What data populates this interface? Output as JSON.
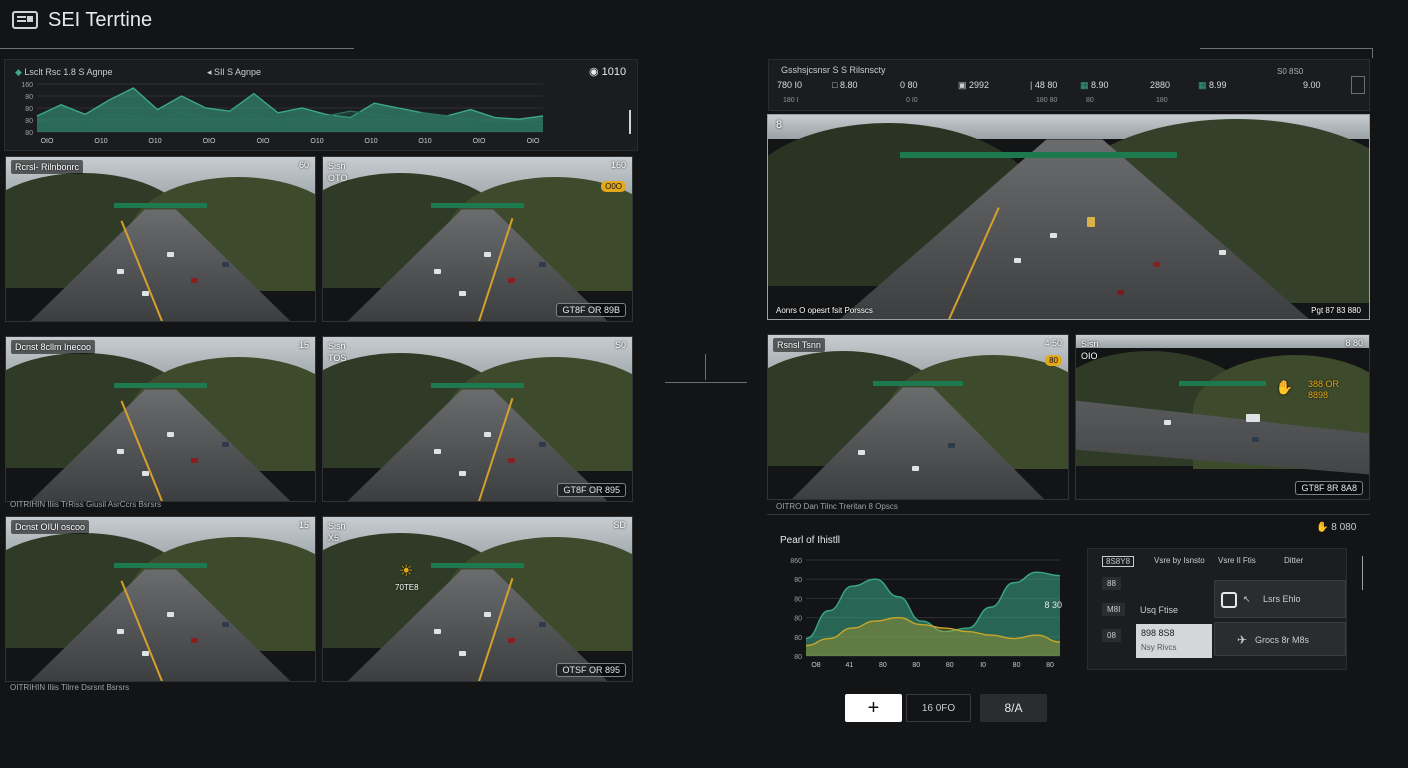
{
  "app": {
    "title": "SEI Terrtine"
  },
  "top_chart": {
    "title": "Lsclt Rsc 1.8 S Agnpe",
    "subtitle": "SIl S Agnpe",
    "right_value": "1010",
    "y_ticks": [
      "160",
      "80",
      "80",
      "80",
      "80"
    ],
    "x_ticks": [
      "OIO",
      "O10",
      "O10",
      "OIO",
      "OIO",
      "O10",
      "O10",
      "O10",
      "OIO",
      "OIO"
    ],
    "chart_data": {
      "type": "area",
      "series": [
        {
          "values": [
            20,
            34,
            22,
            40,
            55,
            28,
            45,
            30,
            26,
            48,
            24,
            30,
            22,
            18,
            36,
            30,
            24,
            20,
            28,
            18,
            16,
            20
          ]
        },
        {
          "values": [
            12,
            18,
            15,
            22,
            20,
            16,
            24,
            18,
            16,
            22,
            14,
            18,
            20,
            26,
            22,
            18,
            24,
            20,
            16,
            12,
            14,
            10
          ]
        }
      ],
      "colors": [
        "#3aa889",
        "#2a6e5c"
      ]
    }
  },
  "left_grid": {
    "tiles": [
      {
        "label": "Rcrsl- Rilnbonrc",
        "num": "60"
      },
      {
        "label": "Sisn\nOTO",
        "num": "160",
        "badge": "O0O",
        "chip": "GT8F OR 89B"
      },
      {
        "label": "Dcnst 8cllm Inecoo",
        "num": "15"
      },
      {
        "label": "Sisn\nTOS",
        "num": "S0",
        "chip": "GT8F OR 895"
      },
      {
        "label": "Dcnst OIUl oscoo",
        "num": "15"
      },
      {
        "label": "Sisn\nX5",
        "num": "SD",
        "note": "70TE8",
        "chip": "OTSF OR 895"
      }
    ],
    "captions": [
      "OITRIHIN Iliis TrRiss Giusil AsrCcrs Bsrsrs",
      "OITRIHIN Iliis Tilrre Dsrsnt Bsrsrs"
    ]
  },
  "right_panel": {
    "stats_title": "Gsshsjcsnsr S S Rilsnscty",
    "stats": [
      {
        "value": "780 I0",
        "sub": "180 I"
      },
      {
        "value": "8.80",
        "sub": ""
      },
      {
        "value": "0 80",
        "sub": "0 I0"
      },
      {
        "value": "2992",
        "sub": ""
      },
      {
        "value": "48 80",
        "sub": "180 80"
      },
      {
        "value": "8.90",
        "sub": "80"
      },
      {
        "value": "2880",
        "sub": "180"
      },
      {
        "value": "8.99",
        "sub": ""
      },
      {
        "value": "9.00",
        "sub": ""
      }
    ],
    "stats_right_label": "S0 8S0",
    "main_cam": {
      "num_label": "8",
      "caption_left": "Aonrs O opesrt fsit Porsscs",
      "caption_right": "Pgt 87 83 880"
    },
    "tiles": [
      {
        "label": "Rsnsl Tsnn",
        "num": "4 50",
        "badge": "80"
      },
      {
        "label": "Sisn\nOIO",
        "num": "8 80",
        "note": "388 OR\n8898",
        "chip": "GT8F 8R 8A8"
      }
    ],
    "tiles_caption": "OITRO Dan Tilnc Treritan 8 Opscs",
    "bottom_right_value": "8 080"
  },
  "bottom_chart": {
    "title": "Pearl of Ihistll",
    "y_ticks": [
      "860",
      "80",
      "80",
      "80",
      "80",
      "80"
    ],
    "x_ticks": [
      "O8",
      "41",
      "80",
      "80",
      "80",
      "I0",
      "80",
      "80"
    ],
    "right_value": "8 30",
    "chart_data": {
      "type": "area",
      "series": [
        {
          "values": [
            10,
            26,
            40,
            44,
            34,
            20,
            14,
            16,
            28,
            42,
            48,
            46
          ]
        },
        {
          "values": [
            6,
            10,
            16,
            20,
            22,
            18,
            16,
            14,
            12,
            10,
            12,
            8
          ]
        }
      ],
      "colors": [
        "#3aa889",
        "#c9a628"
      ]
    }
  },
  "menu": {
    "tabs": [
      "8S8Y8",
      "Vsre by Isnsto",
      "Vsre Il Ftis",
      "Ditter"
    ],
    "left_items": [
      "88",
      "M8I",
      "08"
    ],
    "items": [
      {
        "label": "Lsrs Ehlo"
      },
      {
        "label": "Grocs 8r M8s"
      }
    ],
    "list": [
      {
        "label": "Usq Ftise"
      },
      {
        "label": "898 8S8",
        "sub": "Nsy Rivcs"
      }
    ]
  },
  "actions": {
    "add_label": "+",
    "mid_label": "16 0FO",
    "right_label": "8/A"
  }
}
